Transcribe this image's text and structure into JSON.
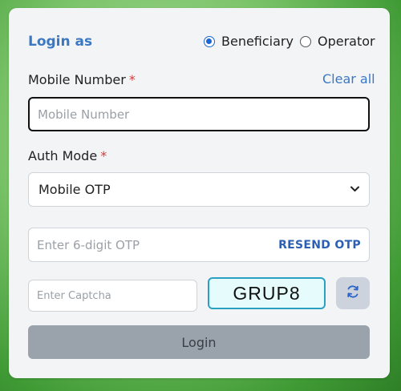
{
  "header": {
    "title": "Login as",
    "role_options": [
      {
        "label": "Beneficiary",
        "selected": true
      },
      {
        "label": "Operator",
        "selected": false
      }
    ]
  },
  "mobile": {
    "label": "Mobile Number",
    "required_mark": "*",
    "clear_label": "Clear all",
    "placeholder": "Mobile Number",
    "value": ""
  },
  "auth": {
    "label": "Auth Mode",
    "required_mark": "*",
    "selected": "Mobile OTP"
  },
  "otp": {
    "placeholder": "Enter 6-digit OTP",
    "resend_label": "RESEND OTP"
  },
  "captcha": {
    "placeholder": "Enter Captcha",
    "code": "GRUP8"
  },
  "login_button": "Login",
  "colors": {
    "accent": "#3a78c4",
    "radio_selected": "#1b66d2",
    "required": "#d63b3b",
    "login_disabled": "#9aa2ab"
  },
  "icons": {
    "refresh": "refresh-icon",
    "select_chevron": "chevron-down-icon"
  }
}
